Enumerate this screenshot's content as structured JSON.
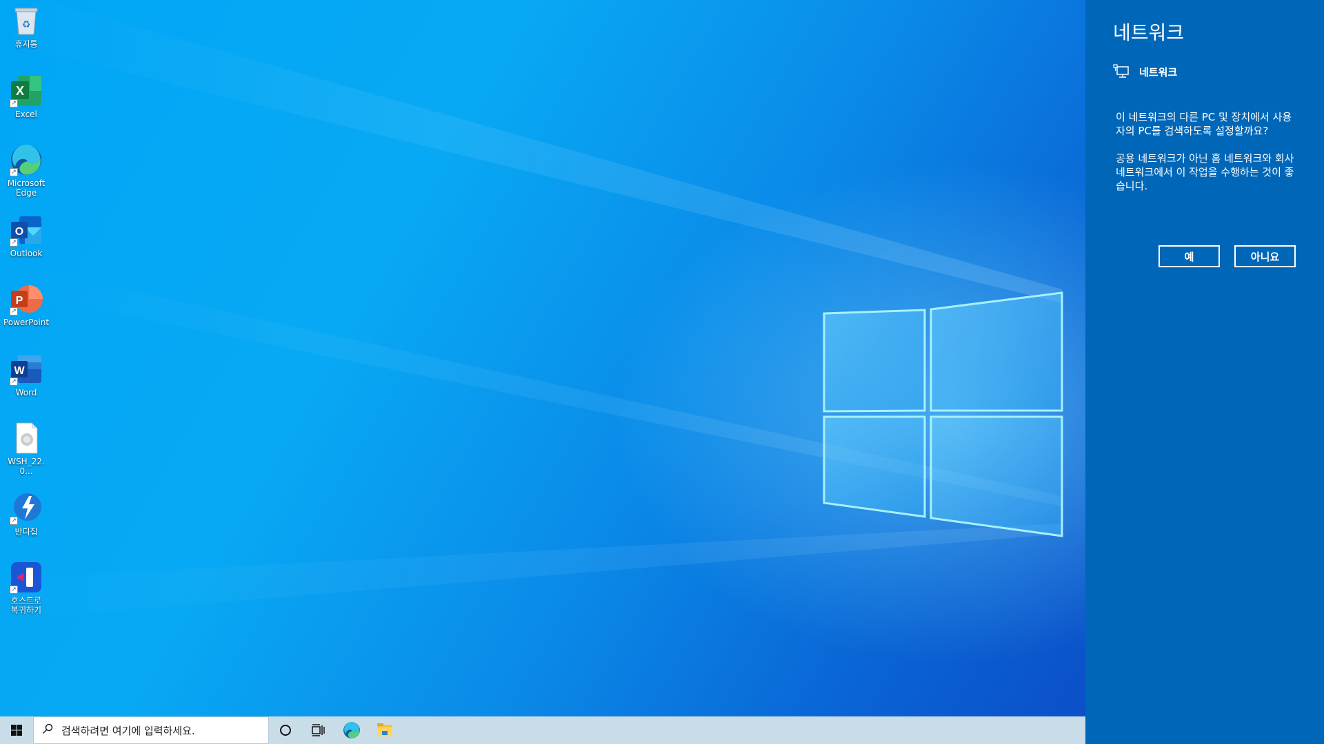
{
  "desktop": {
    "icons": [
      {
        "label": "휴지통",
        "icon": "recycle-bin-icon"
      },
      {
        "label": "Excel",
        "icon": "excel-icon"
      },
      {
        "label": "Microsoft\nEdge",
        "icon": "edge-icon"
      },
      {
        "label": "Outlook",
        "icon": "outlook-icon"
      },
      {
        "label": "PowerPoint",
        "icon": "powerpoint-icon"
      },
      {
        "label": "Word",
        "icon": "word-icon"
      },
      {
        "label": "WSH_22.0...",
        "icon": "file-icon"
      },
      {
        "label": "반디집",
        "icon": "bandizip-icon"
      },
      {
        "label": "호스트로\n복귀하기",
        "icon": "return-to-host-icon"
      }
    ]
  },
  "taskbar": {
    "search_placeholder": "검색하려면 여기에 입력하세요.",
    "buttons": [
      "start-icon",
      "cortana-icon",
      "task-view-icon",
      "edge-icon",
      "file-explorer-icon"
    ]
  },
  "network_panel": {
    "title": "네트워크",
    "network_name": "네트워크",
    "question": "이 네트워크의 다른 PC 및 장치에서 사용자의 PC를 검색하도록 설정할까요?",
    "advice": "공용 네트워크가 아닌 홈 네트워크와 회사 네트워크에서 이 작업을 수행하는 것이 좋습니다.",
    "yes_label": "예",
    "no_label": "아니요"
  },
  "colors": {
    "panel_bg": "#0067b8",
    "taskbar_bg": "#c9dde9",
    "wallpaper_blue": "#0a8be9"
  }
}
